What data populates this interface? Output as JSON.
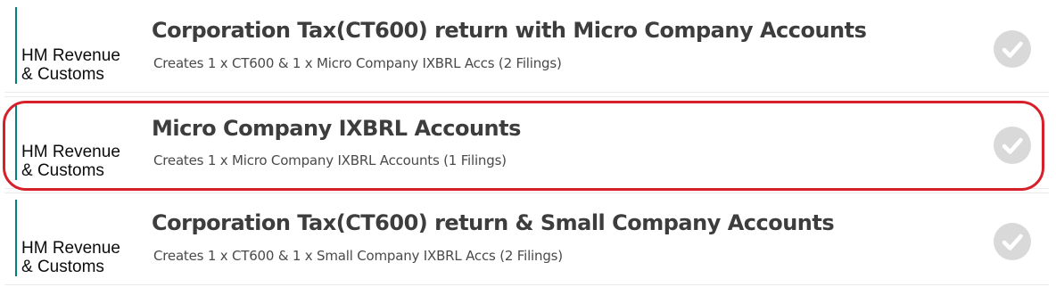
{
  "colors": {
    "accent_bar": "#00827d",
    "highlight_outline": "#d6202a",
    "check_background": "#d9d9d9"
  },
  "filings": [
    {
      "agency_line1": "HM Revenue",
      "agency_line2": "& Customs",
      "title": "Corporation Tax(CT600) return with Micro Company Accounts",
      "description": "Creates 1 x CT600 & 1 x Micro Company IXBRL Accs (2 Filings)",
      "selected_icon": "check-circle-icon"
    },
    {
      "agency_line1": "HM Revenue",
      "agency_line2": "& Customs",
      "title": "Micro Company IXBRL Accounts",
      "description": "Creates 1 x Micro Company IXBRL Accounts (1 Filings)",
      "selected_icon": "check-circle-icon",
      "highlighted": true
    },
    {
      "agency_line1": "HM Revenue",
      "agency_line2": "& Customs",
      "title": "Corporation Tax(CT600) return & Small Company Accounts",
      "description": "Creates 1 x CT600 & 1 x Small Company IXBRL Accs (2 Filings)",
      "selected_icon": "check-circle-icon"
    }
  ]
}
